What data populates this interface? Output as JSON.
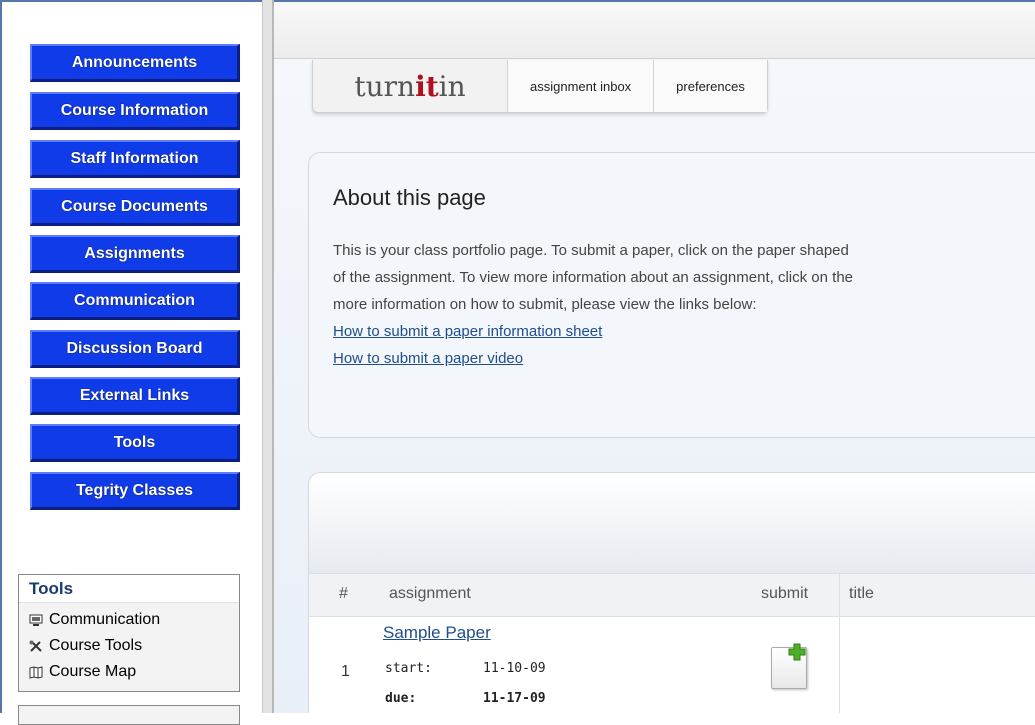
{
  "nav": {
    "buttons": [
      "Announcements",
      "Course Information",
      "Staff Information",
      "Course Documents",
      "Assignments",
      "Communication",
      "Discussion Board",
      "External Links",
      "Tools",
      "Tegrity Classes"
    ]
  },
  "tools_panel": {
    "title": "Tools",
    "items": [
      {
        "label": "Communication",
        "icon": "monitor-icon"
      },
      {
        "label": "Course Tools",
        "icon": "tools-icon"
      },
      {
        "label": "Course Map",
        "icon": "map-icon"
      }
    ]
  },
  "turnitin": {
    "logo_pre": "turn",
    "logo_it": "it",
    "logo_post": "in",
    "tabs": [
      "assignment inbox",
      "preferences"
    ],
    "brand_color": "#b0101d"
  },
  "about": {
    "title": "About this page",
    "lines": [
      "This is your class portfolio page. To submit a paper, click on the paper shaped",
      "of the assignment. To view more information about an assignment, click on the",
      "more information on how to submit, please view the links below:"
    ],
    "link1": "How to submit a paper information sheet",
    "link2": "How to submit a paper video"
  },
  "assignments": {
    "headers": {
      "num": "#",
      "assignment": "assignment",
      "submit": "submit",
      "title": "title"
    },
    "rows": [
      {
        "num": "1",
        "name": "Sample Paper",
        "start_label": "start:",
        "start": "11-10-09",
        "due_label": "due:",
        "due": "11-17-09"
      }
    ]
  }
}
